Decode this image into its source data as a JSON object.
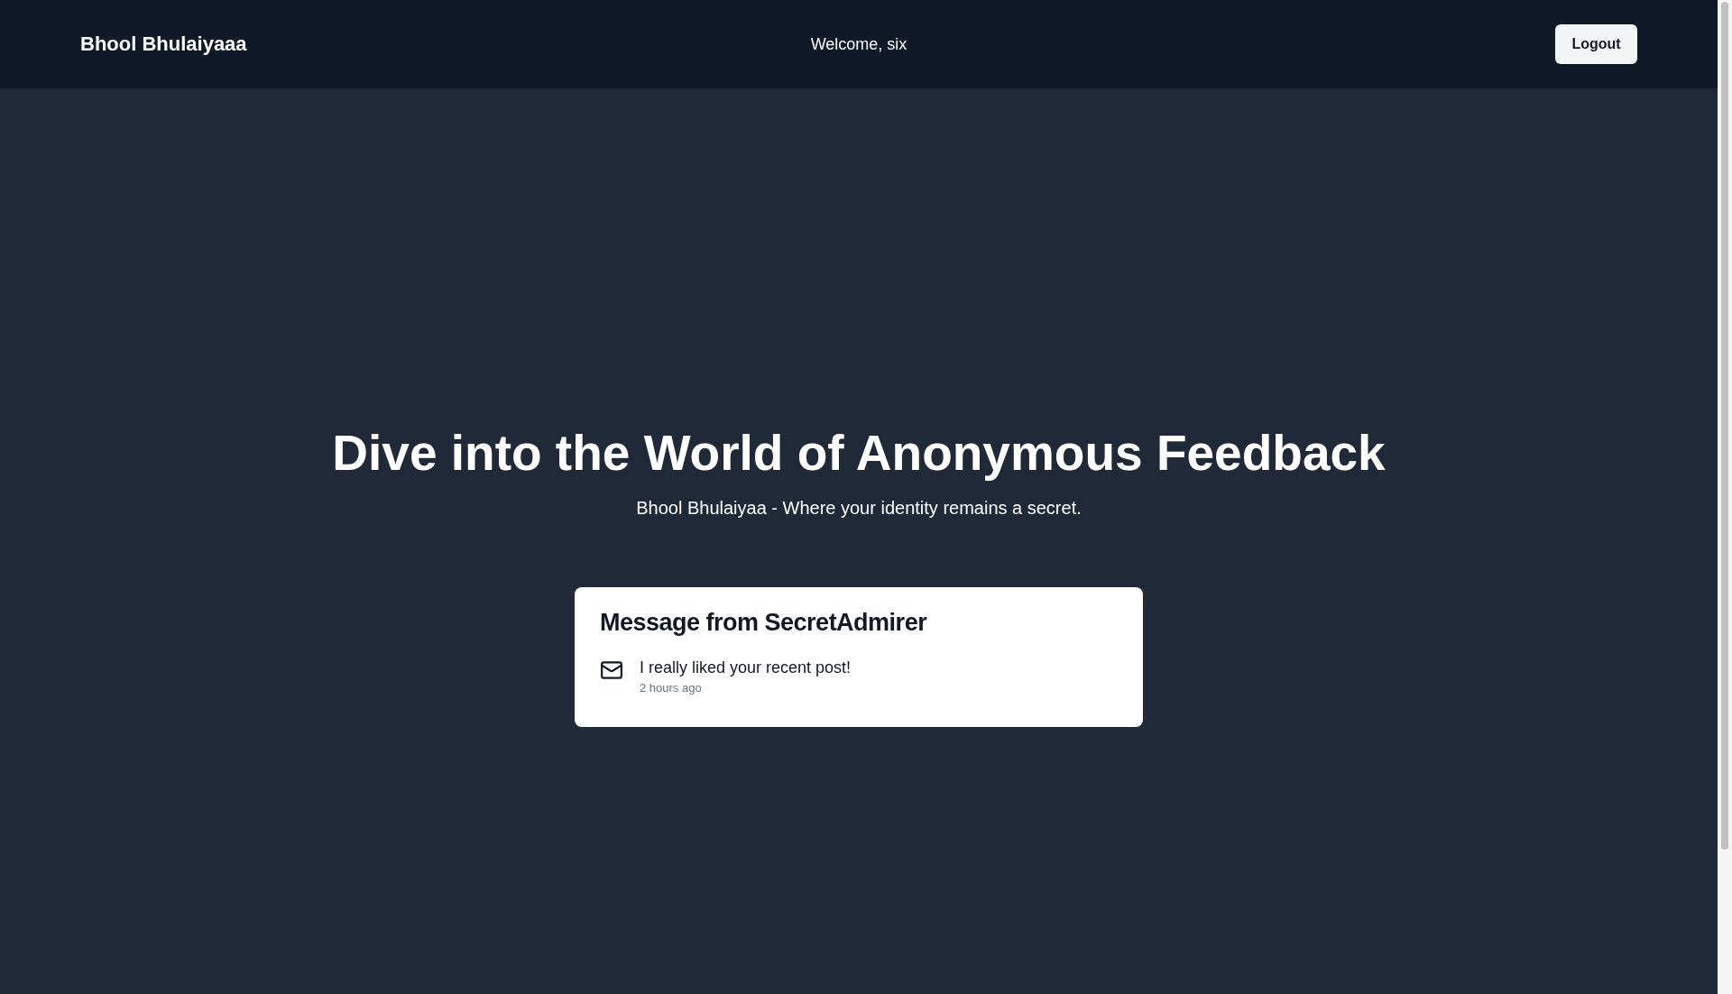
{
  "header": {
    "brand": "Bhool Bhulaiyaaa",
    "welcome": "Welcome, six",
    "logout": "Logout"
  },
  "hero": {
    "title": "Dive into the World of Anonymous Feedback",
    "subtitle": "Bhool Bhulaiyaa - Where your identity remains a secret."
  },
  "message_card": {
    "title": "Message from SecretAdmirer",
    "text": "I really liked your recent post!",
    "time": "2 hours ago"
  }
}
